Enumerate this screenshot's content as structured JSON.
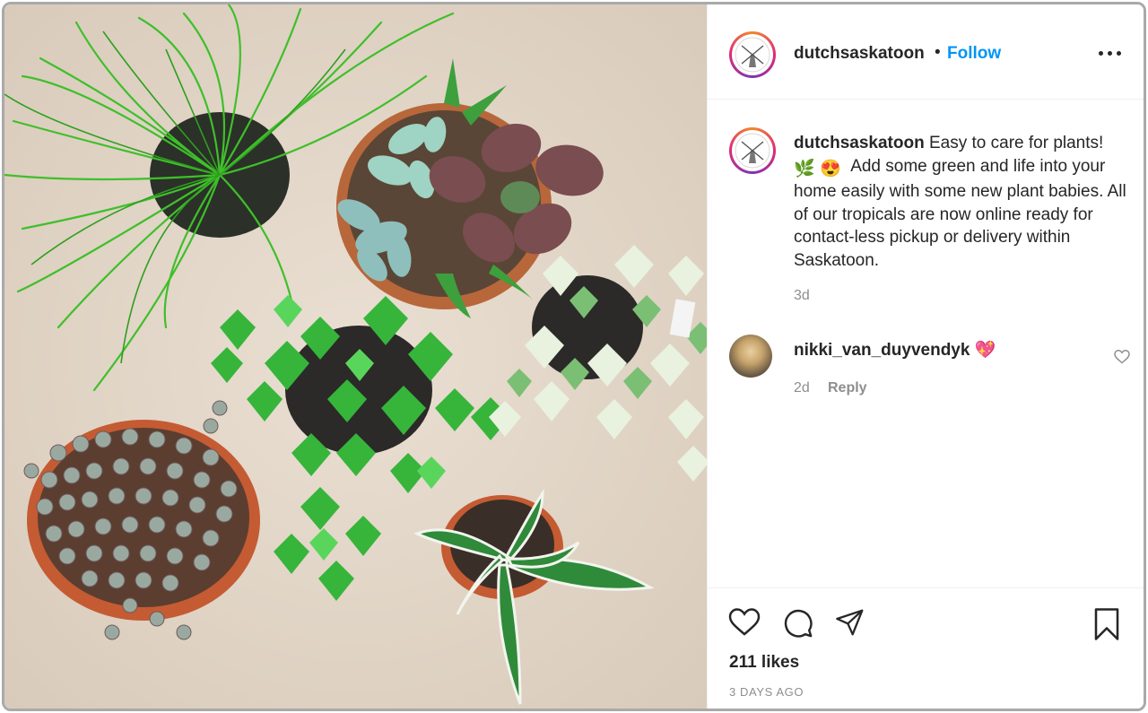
{
  "post": {
    "username": "dutchsaskatoon",
    "separator": "•",
    "follow_label": "Follow",
    "more_icon": "more-options-icon",
    "image_alt": "Overhead photo of potted houseplants: grass, succulents, ivy and string of hearts",
    "caption": {
      "username": "dutchsaskatoon",
      "line1": "Easy to care for plants!",
      "emoji1": "🌿",
      "emoji2": "😍",
      "rest": "Add some green and life into your home easily with some new plant babies. All of our tropicals are now online ready for contact-less pickup or delivery within Saskatoon."
    },
    "caption_time": "3d",
    "comment": {
      "username": "nikki_van_duyvendyk",
      "emoji": "💖",
      "time": "2d",
      "reply_label": "Reply"
    },
    "likes": "211 likes",
    "date": "3 DAYS AGO"
  }
}
